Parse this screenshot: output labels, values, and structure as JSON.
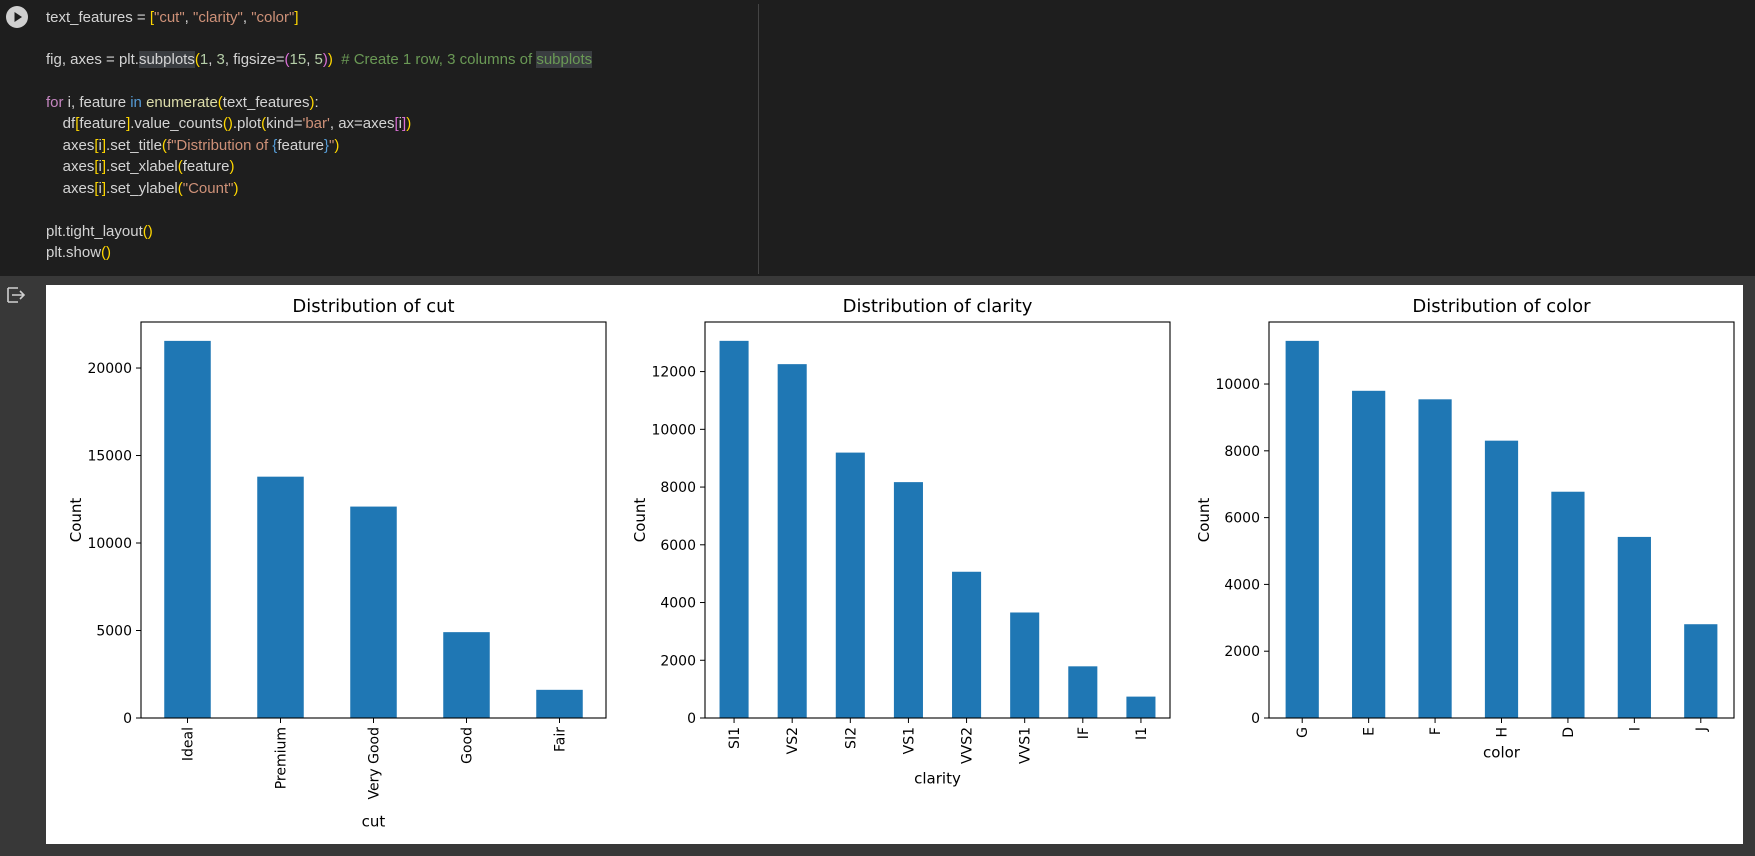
{
  "code": {
    "lines": [
      [
        {
          "t": "text_features = ",
          "c": "ident"
        },
        {
          "t": "[",
          "c": "b1"
        },
        {
          "t": "\"cut\"",
          "c": "str"
        },
        {
          "t": ", ",
          "c": "ident"
        },
        {
          "t": "\"clarity\"",
          "c": "str"
        },
        {
          "t": ", ",
          "c": "ident"
        },
        {
          "t": "\"color\"",
          "c": "str"
        },
        {
          "t": "]",
          "c": "b1"
        }
      ],
      [],
      [
        {
          "t": "fig, axes = plt.",
          "c": "ident"
        },
        {
          "t": "subplots",
          "c": "ident",
          "hl": true
        },
        {
          "t": "(",
          "c": "b1"
        },
        {
          "t": "1",
          "c": "num"
        },
        {
          "t": ", ",
          "c": "ident"
        },
        {
          "t": "3",
          "c": "num"
        },
        {
          "t": ", figsize=",
          "c": "ident"
        },
        {
          "t": "(",
          "c": "b2"
        },
        {
          "t": "15",
          "c": "num"
        },
        {
          "t": ", ",
          "c": "ident"
        },
        {
          "t": "5",
          "c": "num"
        },
        {
          "t": ")",
          "c": "b2"
        },
        {
          "t": ")",
          "c": "b1"
        },
        {
          "t": "  # Create 1 row, 3 columns of ",
          "c": "com"
        },
        {
          "t": "subplots",
          "c": "com",
          "hl": true
        }
      ],
      [],
      [
        {
          "t": "for",
          "c": "kw"
        },
        {
          "t": " i, feature ",
          "c": "ident"
        },
        {
          "t": "in",
          "c": "in"
        },
        {
          "t": " ",
          "c": "ident"
        },
        {
          "t": "enumerate",
          "c": "fn"
        },
        {
          "t": "(",
          "c": "b1"
        },
        {
          "t": "text_features",
          "c": "ident"
        },
        {
          "t": ")",
          "c": "b1"
        },
        {
          "t": ":",
          "c": "ident"
        }
      ],
      [
        {
          "t": "    df",
          "c": "ident"
        },
        {
          "t": "[",
          "c": "b1"
        },
        {
          "t": "feature",
          "c": "ident"
        },
        {
          "t": "]",
          "c": "b1"
        },
        {
          "t": ".value_counts",
          "c": "ident"
        },
        {
          "t": "(",
          "c": "b1"
        },
        {
          "t": ")",
          "c": "b1"
        },
        {
          "t": ".plot",
          "c": "ident"
        },
        {
          "t": "(",
          "c": "b1"
        },
        {
          "t": "kind=",
          "c": "ident"
        },
        {
          "t": "'bar'",
          "c": "str"
        },
        {
          "t": ", ax=axes",
          "c": "ident"
        },
        {
          "t": "[",
          "c": "b2"
        },
        {
          "t": "i",
          "c": "ident"
        },
        {
          "t": "]",
          "c": "b2"
        },
        {
          "t": ")",
          "c": "b1"
        }
      ],
      [
        {
          "t": "    axes",
          "c": "ident"
        },
        {
          "t": "[",
          "c": "b1"
        },
        {
          "t": "i",
          "c": "ident"
        },
        {
          "t": "]",
          "c": "b1"
        },
        {
          "t": ".set_title",
          "c": "ident"
        },
        {
          "t": "(",
          "c": "b1"
        },
        {
          "t": "f\"Distribution of ",
          "c": "str"
        },
        {
          "t": "{",
          "c": "in"
        },
        {
          "t": "feature",
          "c": "ident"
        },
        {
          "t": "}",
          "c": "in"
        },
        {
          "t": "\"",
          "c": "str"
        },
        {
          "t": ")",
          "c": "b1"
        }
      ],
      [
        {
          "t": "    axes",
          "c": "ident"
        },
        {
          "t": "[",
          "c": "b1"
        },
        {
          "t": "i",
          "c": "ident"
        },
        {
          "t": "]",
          "c": "b1"
        },
        {
          "t": ".set_xlabel",
          "c": "ident"
        },
        {
          "t": "(",
          "c": "b1"
        },
        {
          "t": "feature",
          "c": "ident"
        },
        {
          "t": ")",
          "c": "b1"
        }
      ],
      [
        {
          "t": "    axes",
          "c": "ident"
        },
        {
          "t": "[",
          "c": "b1"
        },
        {
          "t": "i",
          "c": "ident"
        },
        {
          "t": "]",
          "c": "b1"
        },
        {
          "t": ".set_ylabel",
          "c": "ident"
        },
        {
          "t": "(",
          "c": "b1"
        },
        {
          "t": "\"Count\"",
          "c": "str"
        },
        {
          "t": ")",
          "c": "b1"
        }
      ],
      [],
      [
        {
          "t": "plt.tight_layout",
          "c": "ident"
        },
        {
          "t": "(",
          "c": "b1"
        },
        {
          "t": ")",
          "c": "b1"
        }
      ],
      [
        {
          "t": "plt.show",
          "c": "ident"
        },
        {
          "t": "(",
          "c": "b1"
        },
        {
          "t": ")",
          "c": "b1"
        }
      ]
    ]
  },
  "colors": {
    "bar": "#1f77b4",
    "ident": "#d4d4d4",
    "str": "#ce9178",
    "num": "#b5cea8",
    "kw": "#c586c0",
    "in": "#569cd6",
    "fn": "#dcdcaa",
    "com": "#6a9955",
    "b1": "#ffd700",
    "b2": "#da70d6",
    "b3": "#179fff"
  },
  "icons": {
    "run": "play-circle-icon",
    "output": "output-toggle-icon"
  },
  "chart_data": [
    {
      "type": "bar",
      "title": "Distribution of cut",
      "xlabel": "cut",
      "ylabel": "Count",
      "categories": [
        "Ideal",
        "Premium",
        "Very Good",
        "Good",
        "Fair"
      ],
      "values": [
        21551,
        13791,
        12082,
        4906,
        1610
      ],
      "ylim": [
        0,
        22630
      ],
      "yticks": [
        0,
        5000,
        10000,
        15000,
        20000
      ],
      "ytick_labels": [
        "0",
        "5000",
        "10000",
        "15000",
        "20000"
      ],
      "legend": "none",
      "grid": false
    },
    {
      "type": "bar",
      "title": "Distribution of clarity",
      "xlabel": "clarity",
      "ylabel": "Count",
      "categories": [
        "SI1",
        "VS2",
        "SI2",
        "VS1",
        "VVS2",
        "VVS1",
        "IF",
        "I1"
      ],
      "values": [
        13065,
        12258,
        9194,
        8171,
        5066,
        3655,
        1790,
        741
      ],
      "ylim": [
        0,
        13718
      ],
      "yticks": [
        0,
        2000,
        4000,
        6000,
        8000,
        10000,
        12000
      ],
      "ytick_labels": [
        "0",
        "2000",
        "4000",
        "6000",
        "8000",
        "10000",
        "12000"
      ],
      "legend": "none",
      "grid": false
    },
    {
      "type": "bar",
      "title": "Distribution of color",
      "xlabel": "color",
      "ylabel": "Count",
      "categories": [
        "G",
        "E",
        "F",
        "H",
        "D",
        "I",
        "J"
      ],
      "values": [
        11292,
        9797,
        9542,
        8304,
        6775,
        5422,
        2808
      ],
      "ylim": [
        0,
        11857
      ],
      "yticks": [
        0,
        2000,
        4000,
        6000,
        8000,
        10000
      ],
      "ytick_labels": [
        "0",
        "2000",
        "4000",
        "6000",
        "8000",
        "10000"
      ],
      "legend": "none",
      "grid": false
    }
  ]
}
